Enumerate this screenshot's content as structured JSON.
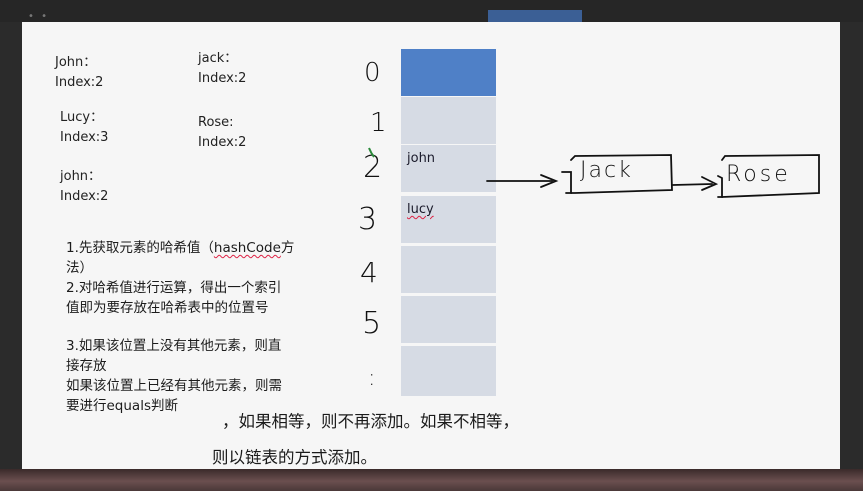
{
  "entries": [
    {
      "name": "John：",
      "index": "Index:2"
    },
    {
      "name": "jack：",
      "index": "Index:2"
    },
    {
      "name": "Lucy：",
      "index": "Index:3"
    },
    {
      "name": "Rose:",
      "index": "Index:2"
    },
    {
      "name": "john：",
      "index": "Index:2"
    }
  ],
  "steps": {
    "step1_line1_prefix": "1.先获取元素的哈希值（",
    "step1_code": "hashCode",
    "step1_line1_suffix": "方",
    "step1_line2": "法）",
    "step2_line1": "2.对哈希值进行运算，得出一个索引",
    "step2_line2": "值即为要存放在哈希表中的位置号",
    "step3_line1": "3.如果该位置上没有其他元素，则直",
    "step3_line2": "接存放",
    "step3_line3": "如果该位置上已经有其他元素，则需",
    "step3_line4": "要进行equals判断"
  },
  "note_line1": "，如果相等，则不再添加。如果不相等，",
  "note_line2": "则以链表的方式添加。",
  "table": {
    "indices": [
      "0",
      "1",
      "2",
      "3",
      "4",
      "5",
      ":"
    ],
    "cells": [
      "",
      "",
      "john",
      "lucy",
      "",
      "",
      ""
    ]
  },
  "chain": [
    "Jack",
    "Rose"
  ],
  "colors": {
    "first_cell": "#4f80c7",
    "cell": "#d6dbe4",
    "slide": "#f6f6f6"
  }
}
